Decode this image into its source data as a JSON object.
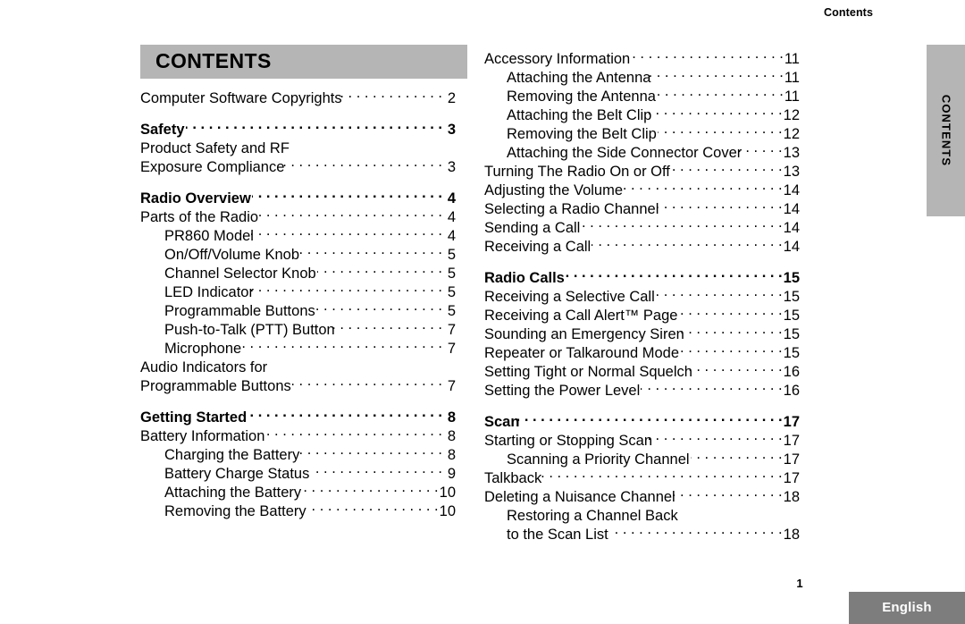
{
  "document": {
    "running_head": "Contents",
    "page_number": "1",
    "language_label": "English",
    "thumb_tab_label": "CONTENTS",
    "title_bar": "CONTENTS",
    "colors": {
      "title_bar_gray": "#b5b5b5",
      "thumb_tab_gray": "#b5b5b5",
      "language_box_gray": "#7d7d7d",
      "text_black": "#000000",
      "page_background": "#ffffff"
    }
  },
  "left_column": {
    "entries": [
      {
        "label": "Computer Software Copyrights",
        "page": "2",
        "level": 1,
        "bold": false,
        "gap_before": false,
        "leader_tight": true
      },
      {
        "label": "Safety",
        "page": "3",
        "level": 1,
        "bold": true,
        "gap_before": true,
        "leader_tight": false
      },
      {
        "label": "Product Safety and RF",
        "page": "",
        "level": 1,
        "bold": false,
        "gap_before": false,
        "continuation": true
      },
      {
        "label": "Exposure Compliance",
        "page": "3",
        "level": 1,
        "bold": false,
        "gap_before": false,
        "leader_tight": true
      },
      {
        "label": "Radio Overview",
        "page": "4",
        "level": 1,
        "bold": true,
        "gap_before": true,
        "leader_tight": false
      },
      {
        "label": "Parts of the Radio",
        "page": "4",
        "level": 1,
        "bold": false,
        "gap_before": false,
        "leader_tight": false
      },
      {
        "label": "PR860 Model",
        "page": "4",
        "level": 2,
        "bold": false,
        "gap_before": false,
        "leader_tight": true
      },
      {
        "label": "On/Off/Volume Knob",
        "page": "5",
        "level": 2,
        "bold": false,
        "gap_before": false,
        "leader_tight": false
      },
      {
        "label": "Channel Selector Knob",
        "page": "5",
        "level": 2,
        "bold": false,
        "gap_before": false,
        "leader_tight": false
      },
      {
        "label": "LED Indicator",
        "page": "5",
        "level": 2,
        "bold": false,
        "gap_before": false,
        "leader_tight": true
      },
      {
        "label": "Programmable Buttons",
        "page": "5",
        "level": 2,
        "bold": false,
        "gap_before": false,
        "leader_tight": false
      },
      {
        "label": "Push-to-Talk (PTT) Button",
        "page": "7",
        "level": 2,
        "bold": false,
        "gap_before": false,
        "leader_tight": true
      },
      {
        "label": "Microphone",
        "page": "7",
        "level": 2,
        "bold": false,
        "gap_before": false,
        "leader_tight": false
      },
      {
        "label": "Audio Indicators for",
        "page": "",
        "level": 1,
        "bold": false,
        "gap_before": false,
        "continuation": true
      },
      {
        "label": "Programmable Buttons",
        "page": "7",
        "level": 1,
        "bold": false,
        "gap_before": false,
        "leader_tight": false
      },
      {
        "label": "Getting Started",
        "page": "8",
        "level": 1,
        "bold": true,
        "gap_before": true,
        "leader_tight": false
      },
      {
        "label": "Battery Information",
        "page": "8",
        "level": 1,
        "bold": false,
        "gap_before": false,
        "leader_tight": false
      },
      {
        "label": "Charging the Battery",
        "page": "8",
        "level": 2,
        "bold": false,
        "gap_before": false,
        "leader_tight": false
      },
      {
        "label": "Battery Charge Status",
        "page": "9",
        "level": 2,
        "bold": false,
        "gap_before": false,
        "leader_tight": false
      },
      {
        "label": "Attaching the Battery",
        "page": "10",
        "level": 2,
        "bold": false,
        "gap_before": false,
        "leader_tight": false
      },
      {
        "label": "Removing the Battery",
        "page": "10",
        "level": 2,
        "bold": false,
        "gap_before": false,
        "leader_tight": false
      }
    ]
  },
  "right_column": {
    "entries": [
      {
        "label": "Accessory Information",
        "page": "11",
        "level": 1,
        "bold": false,
        "gap_before": false,
        "leader_tight": false
      },
      {
        "label": "Attaching the Antenna",
        "page": "11",
        "level": 2,
        "bold": false,
        "gap_before": false,
        "leader_tight": true
      },
      {
        "label": "Removing the Antenna",
        "page": "11",
        "level": 2,
        "bold": false,
        "gap_before": false,
        "leader_tight": false
      },
      {
        "label": "Attaching the Belt Clip",
        "page": "12",
        "level": 2,
        "bold": false,
        "gap_before": false,
        "leader_tight": true
      },
      {
        "label": "Removing the Belt Clip",
        "page": "12",
        "level": 2,
        "bold": false,
        "gap_before": false,
        "leader_tight": false
      },
      {
        "label": "Attaching the Side Connector Cover",
        "page": "13",
        "level": 2,
        "bold": false,
        "gap_before": false,
        "leader_tight": true
      },
      {
        "label": "Turning The Radio On or Off",
        "page": "13",
        "level": 1,
        "bold": false,
        "gap_before": false,
        "leader_tight": false
      },
      {
        "label": "Adjusting the Volume",
        "page": "14",
        "level": 1,
        "bold": false,
        "gap_before": false,
        "leader_tight": false
      },
      {
        "label": "Selecting a Radio Channel",
        "page": "14",
        "level": 1,
        "bold": false,
        "gap_before": false,
        "leader_tight": true
      },
      {
        "label": "Sending a Call",
        "page": "14",
        "level": 1,
        "bold": false,
        "gap_before": false,
        "leader_tight": false
      },
      {
        "label": "Receiving a Call",
        "page": "14",
        "level": 1,
        "bold": false,
        "gap_before": false,
        "leader_tight": false
      },
      {
        "label": "Radio Calls",
        "page": "15",
        "level": 1,
        "bold": true,
        "gap_before": true,
        "leader_tight": false
      },
      {
        "label": "Receiving a Selective Call",
        "page": "15",
        "level": 1,
        "bold": false,
        "gap_before": false,
        "leader_tight": false
      },
      {
        "label": "Receiving a Call Alert™ Page",
        "page": "15",
        "level": 1,
        "bold": false,
        "gap_before": false,
        "leader_tight": false
      },
      {
        "label": "Sounding an Emergency Siren",
        "page": "15",
        "level": 1,
        "bold": false,
        "gap_before": false,
        "leader_tight": true
      },
      {
        "label": "Repeater or Talkaround Mode",
        "page": "15",
        "level": 1,
        "bold": false,
        "gap_before": false,
        "leader_tight": false
      },
      {
        "label": "Setting Tight or Normal Squelch",
        "page": "16",
        "level": 1,
        "bold": false,
        "gap_before": false,
        "leader_tight": true
      },
      {
        "label": "Setting the Power Level",
        "page": "16",
        "level": 1,
        "bold": false,
        "gap_before": false,
        "leader_tight": false
      },
      {
        "label": "Scan",
        "page": "17",
        "level": 1,
        "bold": true,
        "gap_before": true,
        "leader_tight": true
      },
      {
        "label": "Starting or Stopping Scan",
        "page": "17",
        "level": 1,
        "bold": false,
        "gap_before": false,
        "leader_tight": true
      },
      {
        "label": "Scanning a Priority Channel",
        "page": "17",
        "level": 2,
        "bold": false,
        "gap_before": false,
        "leader_tight": false
      },
      {
        "label": "Talkback",
        "page": "17",
        "level": 1,
        "bold": false,
        "gap_before": false,
        "leader_tight": true
      },
      {
        "label": "Deleting a Nuisance Channel",
        "page": "18",
        "level": 1,
        "bold": false,
        "gap_before": false,
        "leader_tight": true
      },
      {
        "label": "Restoring a Channel Back",
        "page": "",
        "level": 2,
        "bold": false,
        "gap_before": false,
        "continuation": true
      },
      {
        "label": "to the Scan List",
        "page": "18",
        "level": 2,
        "bold": false,
        "gap_before": false,
        "leader_tight": false
      }
    ]
  }
}
